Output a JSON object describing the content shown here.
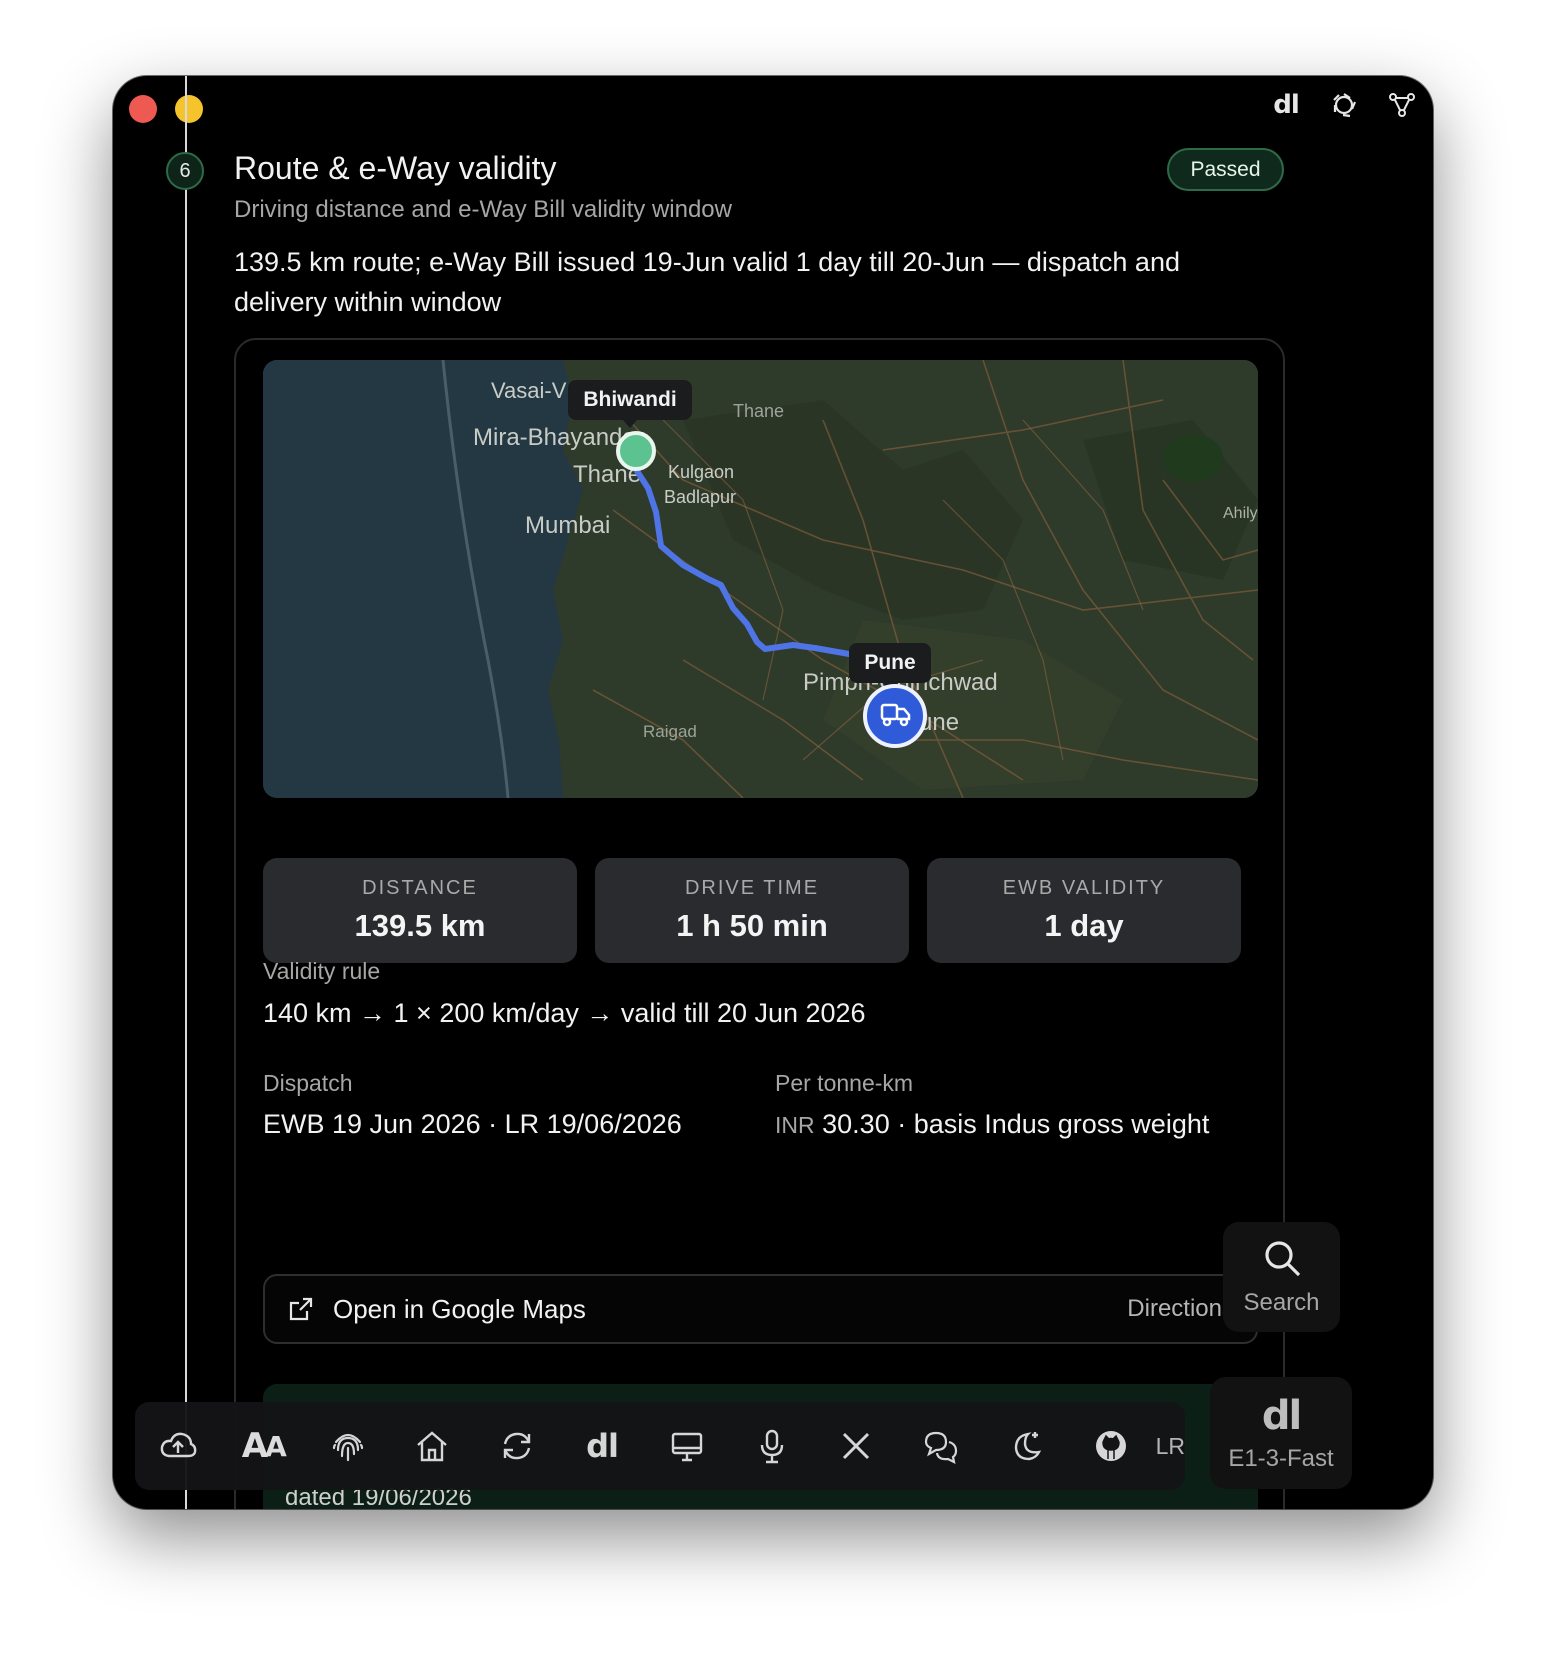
{
  "header": {
    "logo_text": "dl",
    "icons": [
      "dl-logo-icon",
      "openai-icon",
      "graph-nodes-icon"
    ]
  },
  "step": {
    "number": "6",
    "title": "Route & e-Way validity",
    "subtitle": "Driving distance and e-Way Bill validity window",
    "status": "Passed",
    "summary": "139.5 km route; e-Way Bill issued 19-Jun valid 1 day till 20-Jun — dispatch and delivery within window"
  },
  "map": {
    "origin_label": "Bhiwandi",
    "destination_label": "Pune",
    "place_names": [
      "Vasai-Virar",
      "Mira-Bhayandar",
      "Thane",
      "Mumbai",
      "Kulgaon Badlapur",
      "Pimpri-Chinchwad",
      "Pune",
      "Raigad",
      "Ahilya"
    ],
    "colors": {
      "route": "#4f74e6",
      "origin": "#5cc28f",
      "destination": "#2f5bd8"
    }
  },
  "stats": [
    {
      "label": "DISTANCE",
      "value": "139.5 km"
    },
    {
      "label": "DRIVE TIME",
      "value": "1 h 50 min"
    },
    {
      "label": "EWB VALIDITY",
      "value": "1 day"
    }
  ],
  "validity": {
    "label": "Validity rule",
    "value": "140 km → 1 × 200 km/day → valid till 20 Jun 2026"
  },
  "dispatch": {
    "label": "Dispatch",
    "value": "EWB 19 Jun 2026 · LR 19/06/2026"
  },
  "per_tonne": {
    "label": "Per tonne-km",
    "currency": "INR",
    "value": "30.30 · basis Indus gross weight"
  },
  "google_maps": {
    "label": "Open in Google Maps",
    "right": "Directions"
  },
  "next_panel": {
    "text": "dated 19/06/2026"
  },
  "dock": {
    "items": [
      "cloud-upload-icon",
      "text-aa-icon",
      "fingerprint-icon",
      "home-icon",
      "refresh-icon",
      "dl-logo-icon",
      "monitor-icon",
      "microphone-icon",
      "x-logo-icon",
      "chat-bubbles-icon",
      "moon-stars-icon",
      "github-icon"
    ],
    "aa_text": "A",
    "dl_text": "dl",
    "trailing_label": "LR"
  },
  "side": {
    "search_label": "Search",
    "model_logo": "dl",
    "model_label": "E1-3-Fast"
  }
}
